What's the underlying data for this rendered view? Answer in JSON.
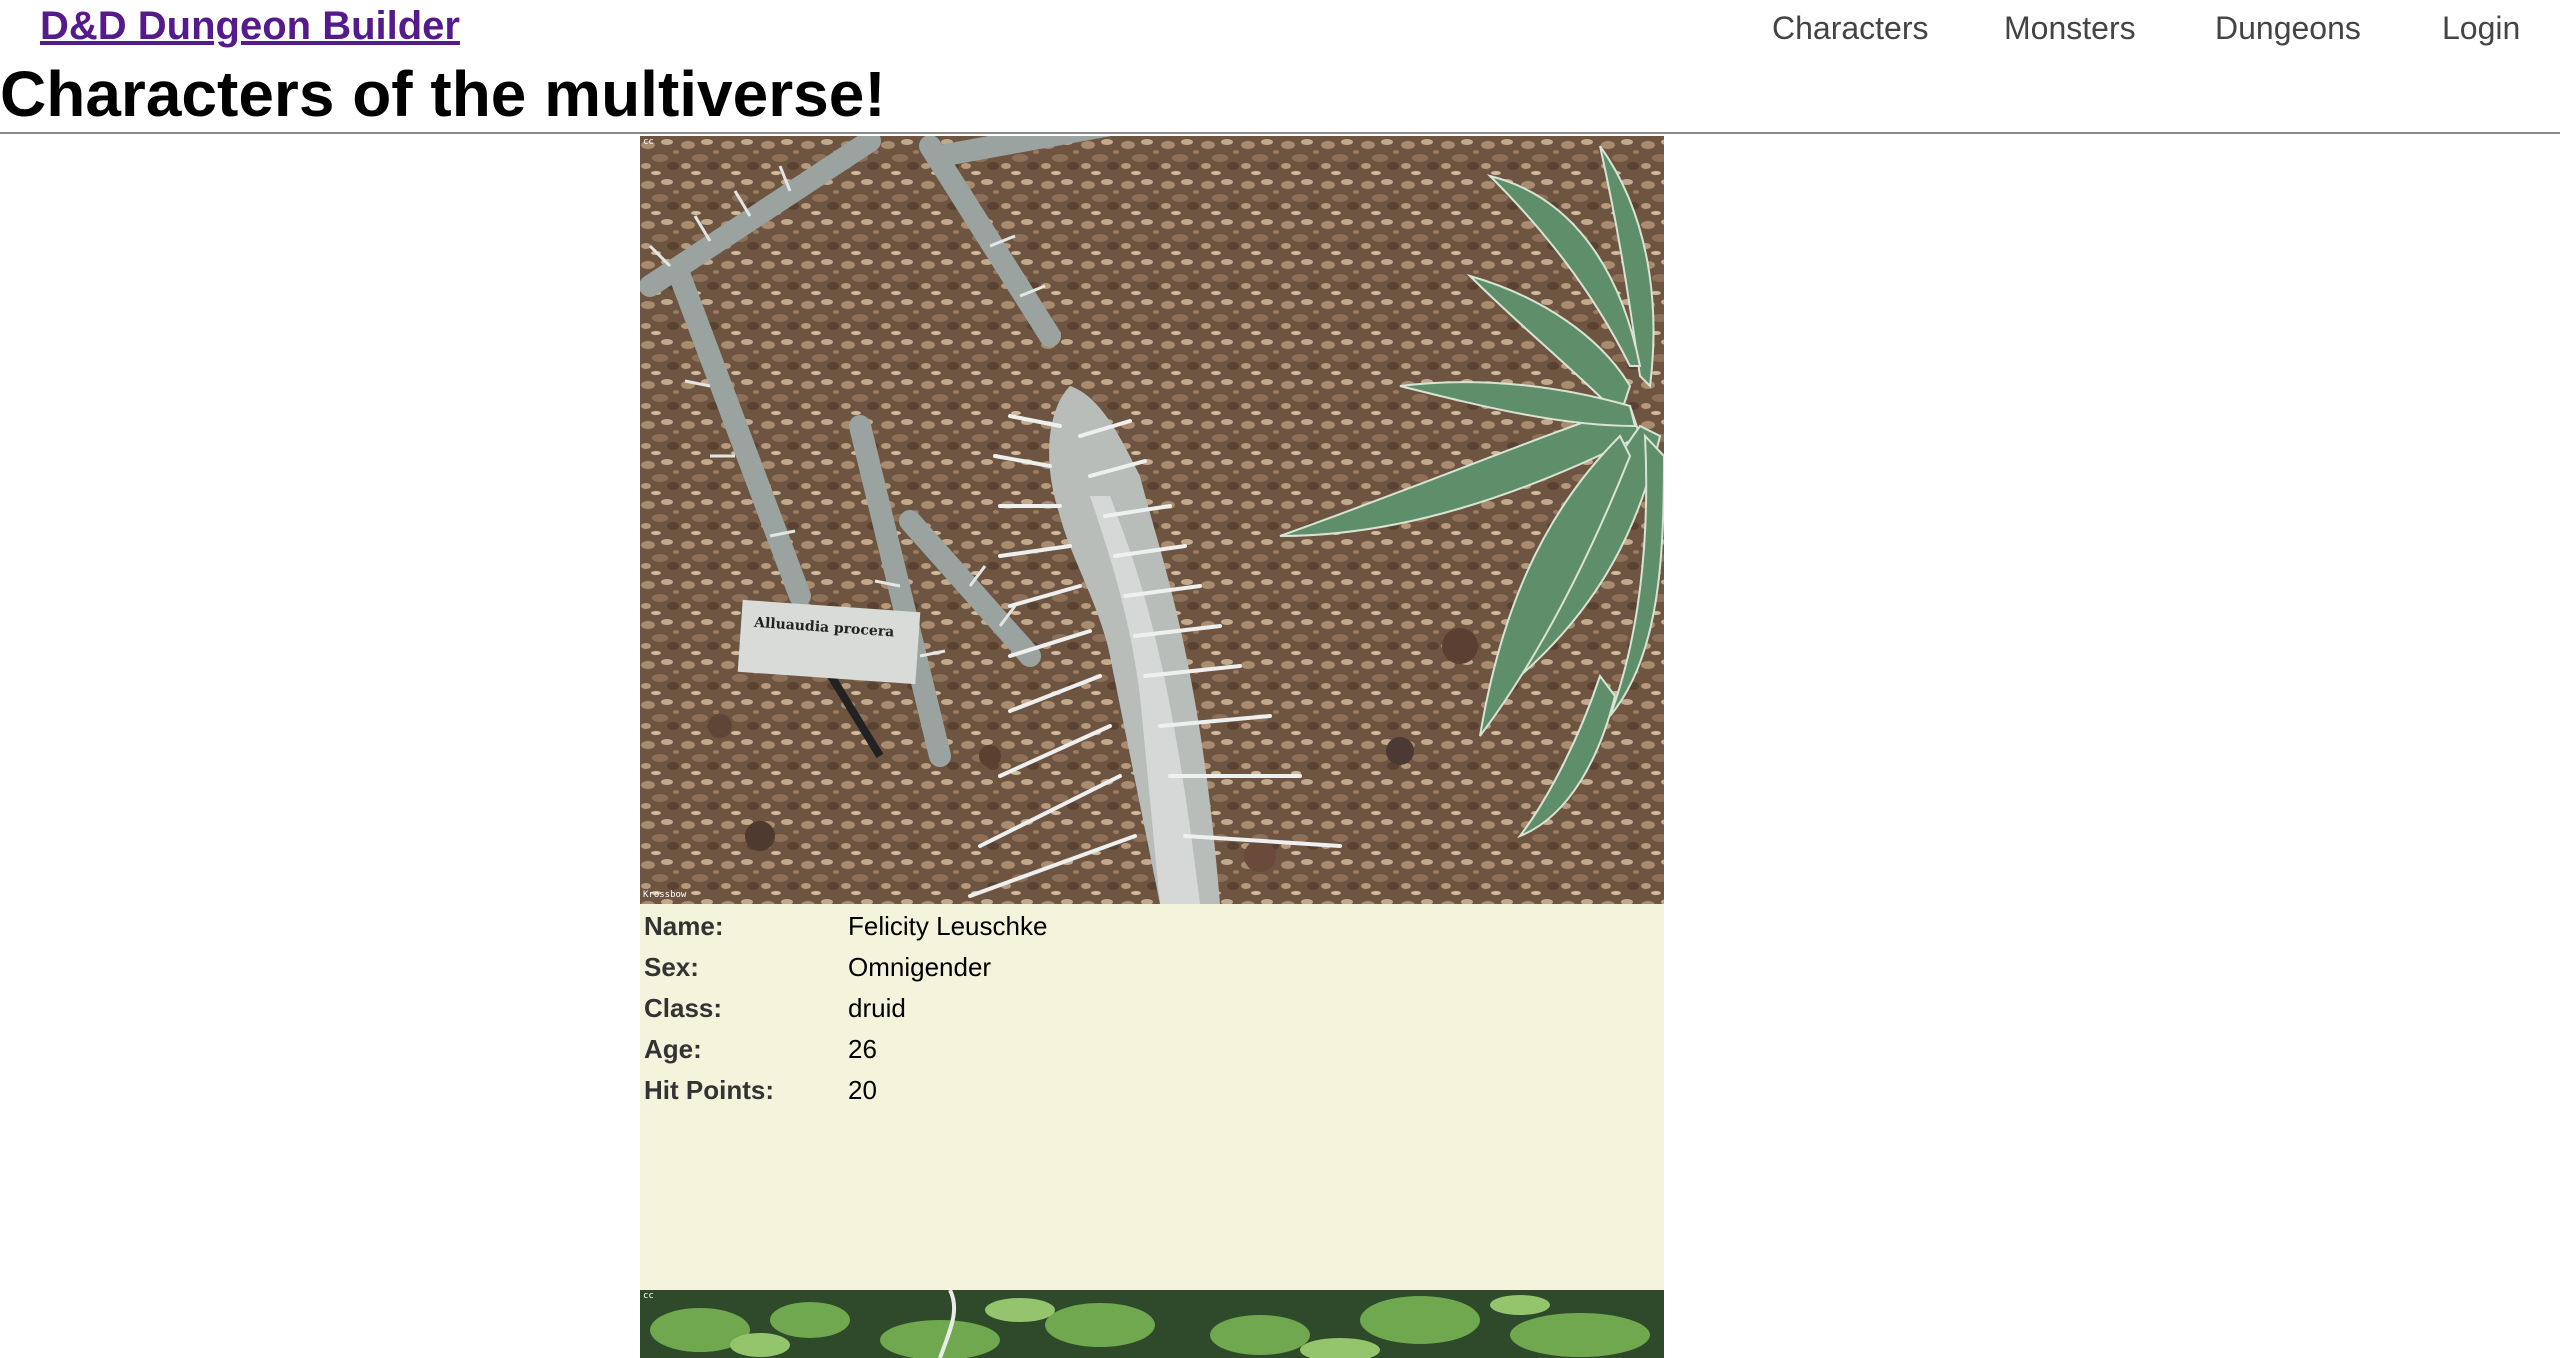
{
  "header": {
    "brand": "D&D Dungeon Builder",
    "nav": [
      "Characters",
      "Monsters",
      "Dungeons",
      "Login"
    ]
  },
  "page": {
    "title": "Characters of the multiverse!"
  },
  "characters": [
    {
      "image_sign_text": "Alluaudia procera",
      "image_cc": "cc",
      "image_credit": "Krossbow",
      "fields": [
        {
          "label": "Name:",
          "value": "Felicity Leuschke"
        },
        {
          "label": "Sex:",
          "value": "Omnigender"
        },
        {
          "label": "Class:",
          "value": "druid"
        },
        {
          "label": "Age:",
          "value": "26"
        },
        {
          "label": "Hit Points:",
          "value": "20"
        }
      ]
    },
    {
      "image_cc": "cc"
    }
  ],
  "colors": {
    "brand_link": "#551a8b",
    "card_background": "#f4f4dc",
    "divider": "#8a8a8a"
  }
}
